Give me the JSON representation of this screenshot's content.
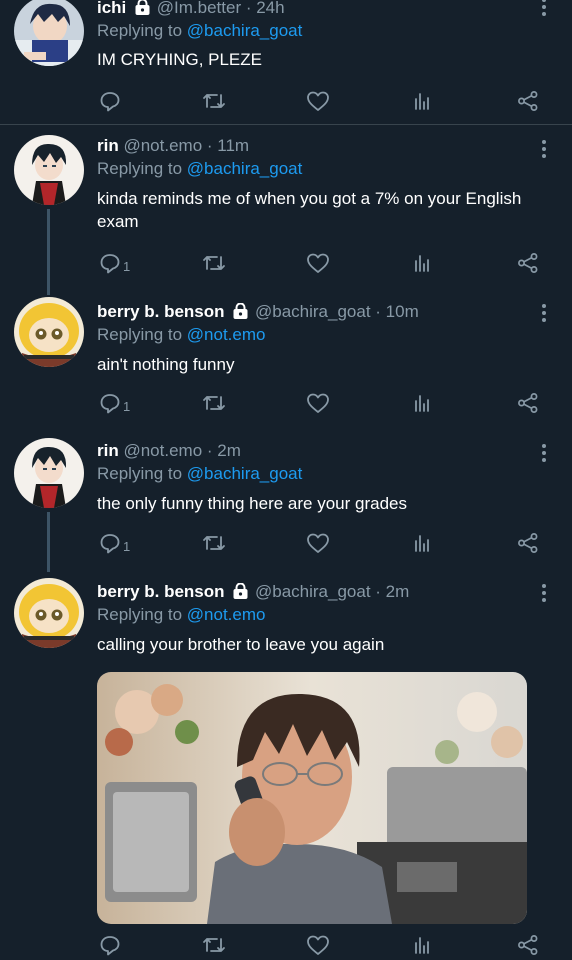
{
  "tweets": [
    {
      "name": "ichi",
      "handle": "@Im.better",
      "time": "· 24h",
      "replying_to": "Replying to",
      "mention": "@bachira_goat",
      "text": "IM CRYHING, PLEZE",
      "reply_count": "",
      "avatar_icon": "avatar-dark-hair-boy"
    },
    {
      "name": "rin",
      "handle": "@not.emo",
      "time": "· 11m",
      "replying_to": "Replying to",
      "mention": "@bachira_goat",
      "text": "kinda reminds me of when you got a 7% on your English exam",
      "reply_count": "1",
      "avatar_icon": "avatar-dark-hair-red-outfit"
    },
    {
      "name": "berry b. benson",
      "handle": "@bachira_goat",
      "time": "· 10m",
      "replying_to": "Replying to",
      "mention": "@not.emo",
      "text": "ain't nothing funny",
      "reply_count": "1",
      "avatar_icon": "avatar-yellow-hood-bee"
    },
    {
      "name": "rin",
      "handle": "@not.emo",
      "time": "· 2m",
      "replying_to": "Replying to",
      "mention": "@bachira_goat",
      "text": "the only funny thing here are your grades",
      "reply_count": "1",
      "avatar_icon": "avatar-dark-hair-red-outfit"
    },
    {
      "name": "berry b. benson",
      "handle": "@bachira_goat",
      "time": "· 2m",
      "replying_to": "Replying to",
      "mention": "@not.emo",
      "text": "calling your brother to leave you again",
      "reply_count": "",
      "avatar_icon": "avatar-yellow-hood-bee",
      "media_icon": "photo-boy-on-phone"
    }
  ],
  "colors": {
    "background": "#15202b",
    "secondary_text": "#8899a6",
    "link": "#1d9bf0",
    "thread_line": "#3d5466",
    "divider": "#38444d"
  }
}
